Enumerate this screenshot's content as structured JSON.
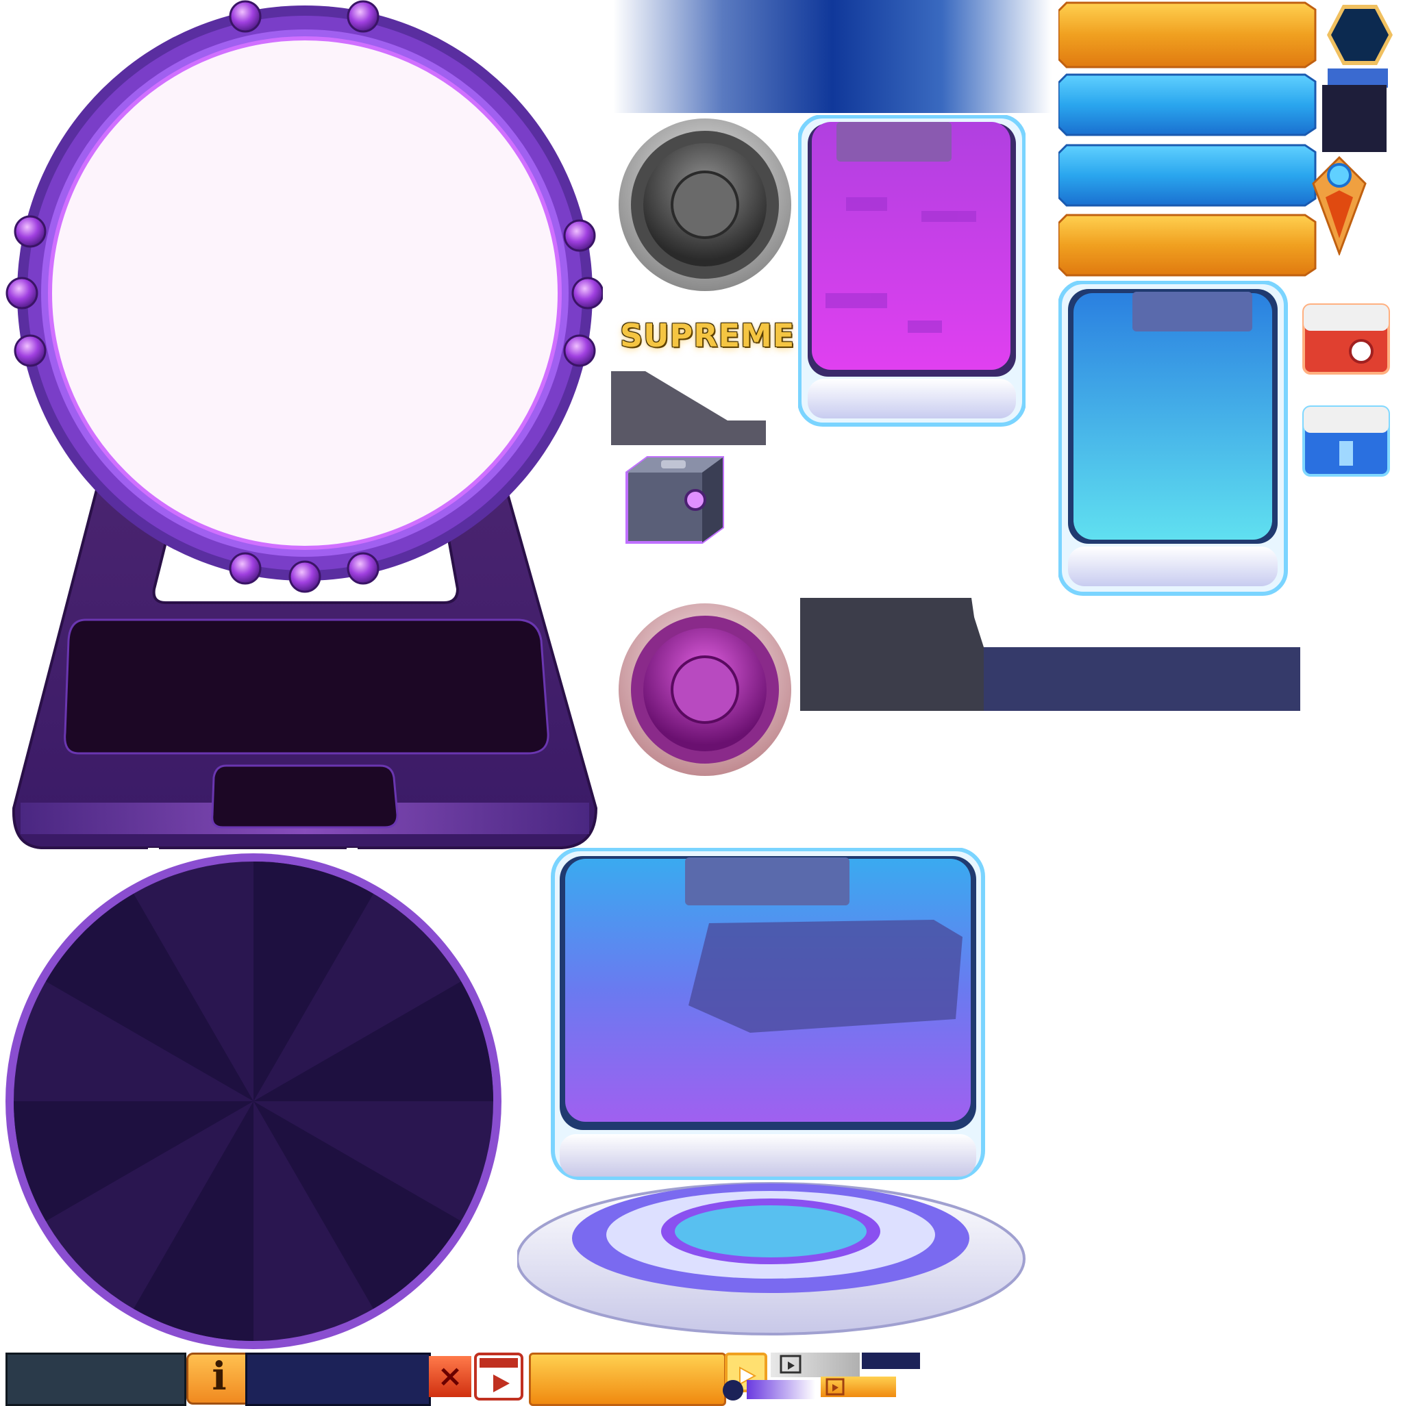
{
  "sprite_sheet": {
    "badge_label": "SUPREME",
    "info_icon_label": "i",
    "close_icon_label": "×",
    "icons": [
      "purple-orb-frame-icon",
      "purple-starburst-disc-icon",
      "blue-holo-pedestal-icon",
      "gray-round-button-icon",
      "pink-round-button-icon",
      "purple-crate-icon",
      "red-crate-icon",
      "blue-crate-icon",
      "map-pin-icon",
      "hexagon-badge-icon",
      "video-clapper-icon",
      "info-icon",
      "close-icon"
    ],
    "colors": {
      "frame_purple": "#5a2ea0",
      "frame_dark": "#1e0b2c",
      "banner_gold": "#f0a020",
      "banner_blue": "#2aa6ee",
      "card_purple": "#c040e0",
      "card_blue": "#38a8e8",
      "panel_slate": "#3c3d4a",
      "panel_navy": "#353a6a"
    }
  }
}
